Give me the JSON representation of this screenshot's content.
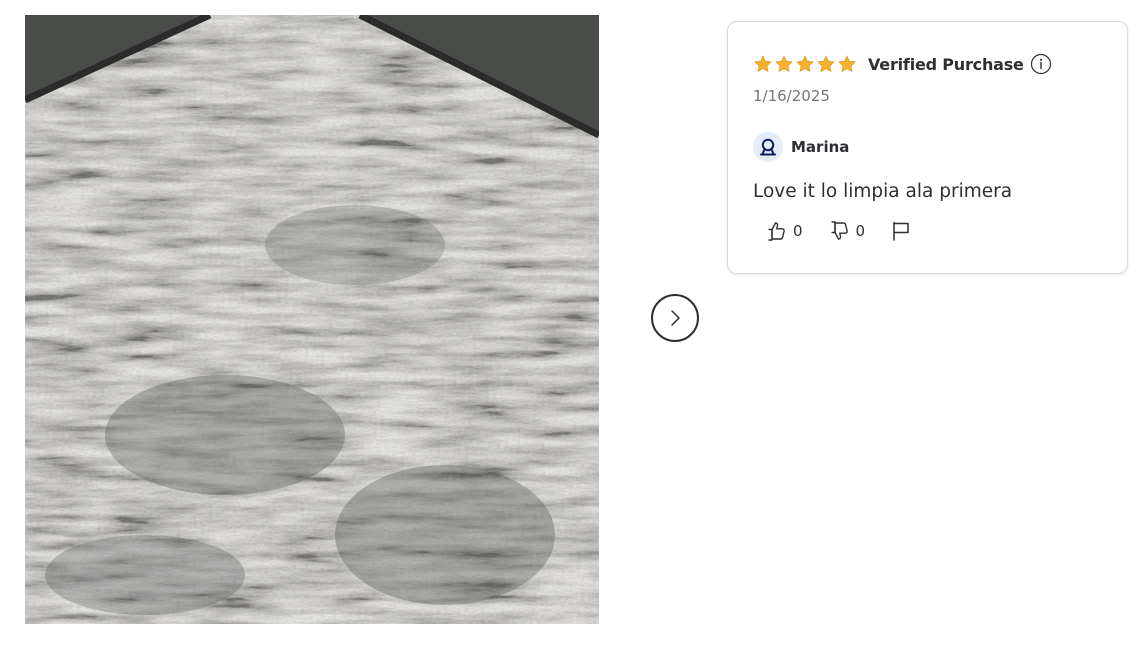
{
  "review": {
    "rating": 5,
    "rating_max": 5,
    "verified_label": "Verified Purchase",
    "date": "1/16/2025",
    "reviewer_name": "Marina",
    "text": "Love it lo limpia ala primera",
    "helpful_count": "0",
    "unhelpful_count": "0"
  },
  "icons": {
    "star": "star-icon",
    "info": "info-icon",
    "avatar": "user-icon",
    "thumbs_up": "thumbs-up-icon",
    "thumbs_down": "thumbs-down-icon",
    "flag": "flag-icon",
    "next": "chevron-right-icon"
  },
  "colors": {
    "star": "#f6b22d",
    "text": "#2e2f32",
    "muted": "#74767c",
    "avatar_bg": "#e4ecf7",
    "avatar_icon": "#0a1f5c"
  }
}
